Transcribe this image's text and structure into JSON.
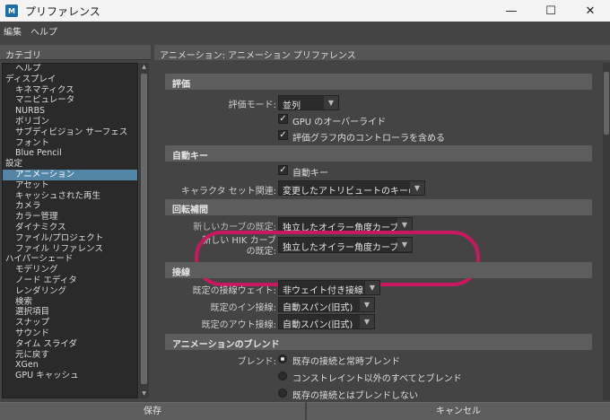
{
  "window": {
    "title": "プリファレンス",
    "app_icon_label": "M",
    "controls": {
      "minimize": "—",
      "maximize": "☐",
      "close": "✕"
    }
  },
  "menubar": {
    "items": [
      "編集",
      "ヘルプ"
    ]
  },
  "left_panel": {
    "header": "カテゴリ",
    "items": [
      {
        "label": "ヘルプ",
        "level": 1
      },
      {
        "label": "ディスプレイ",
        "level": 0
      },
      {
        "label": "キネマティクス",
        "level": 1
      },
      {
        "label": "マニピュレータ",
        "level": 1
      },
      {
        "label": "NURBS",
        "level": 1
      },
      {
        "label": "ポリゴン",
        "level": 1
      },
      {
        "label": "サブディビジョン サーフェス",
        "level": 1
      },
      {
        "label": "フォント",
        "level": 1
      },
      {
        "label": "Blue Pencil",
        "level": 1
      },
      {
        "label": "設定",
        "level": 0
      },
      {
        "label": "アニメーション",
        "level": 1,
        "selected": true
      },
      {
        "label": "アセット",
        "level": 1
      },
      {
        "label": "キャッシュされた再生",
        "level": 1
      },
      {
        "label": "カメラ",
        "level": 1
      },
      {
        "label": "カラー管理",
        "level": 1
      },
      {
        "label": "ダイナミクス",
        "level": 1
      },
      {
        "label": "ファイル/プロジェクト",
        "level": 1
      },
      {
        "label": "ファイル リファレンス",
        "level": 1
      },
      {
        "label": "ハイパーシェード",
        "level": 0
      },
      {
        "label": "モデリング",
        "level": 1
      },
      {
        "label": "ノード エディタ",
        "level": 1
      },
      {
        "label": "レンダリング",
        "level": 1
      },
      {
        "label": "検索",
        "level": 1
      },
      {
        "label": "選択項目",
        "level": 1
      },
      {
        "label": "スナップ",
        "level": 1
      },
      {
        "label": "サウンド",
        "level": 1
      },
      {
        "label": "タイム スライダ",
        "level": 1
      },
      {
        "label": "元に戻す",
        "level": 1
      },
      {
        "label": "XGen",
        "level": 1
      },
      {
        "label": "GPU キャッシュ",
        "level": 1
      }
    ]
  },
  "right_panel": {
    "header": "アニメーション: アニメーション プリファレンス",
    "sections": {
      "eval": {
        "title": "評価",
        "mode_label": "評価モード:",
        "mode_value": "並列",
        "gpu_override": "GPU のオーバーライド",
        "graph_controllers": "評価グラフ内のコントローラを含める"
      },
      "autokey": {
        "title": "自動キー",
        "autokey_label": "自動キー",
        "char_set_label": "キャラクタ セット関連:",
        "char_set_value": "変更したアトリビュートのキーのみ"
      },
      "rotation": {
        "title": "回転補間",
        "new_curve_label": "新しいカーブの既定:",
        "new_curve_value": "独立したオイラー角度カーブ",
        "hik_label_line1": "新しい HIK カーブ",
        "hik_label_line2": "の既定:",
        "hik_value": "独立したオイラー角度カーブ"
      },
      "tangents": {
        "title": "接線",
        "weight_label": "既定の接線ウェイト:",
        "weight_value": "非ウェイト付き接線",
        "in_label": "既定のイン接線:",
        "in_value": "自動スパン(旧式)",
        "out_label": "既定のアウト接線:",
        "out_value": "自動スパン(旧式)"
      },
      "blend": {
        "title": "アニメーションのブレンド",
        "blend_label": "ブレンド:",
        "options": [
          {
            "label": "既存の接続と常時ブレンド",
            "selected": true
          },
          {
            "label": "コンストレイント以外のすべてとブレンド",
            "selected": false
          },
          {
            "label": "既存の接続とはブレンドしない",
            "selected": false
          }
        ]
      }
    }
  },
  "buttons": {
    "save": "保存",
    "cancel": "キャンセル"
  },
  "colors": {
    "selection": "#5285a6",
    "annotation": "#c8185f"
  }
}
